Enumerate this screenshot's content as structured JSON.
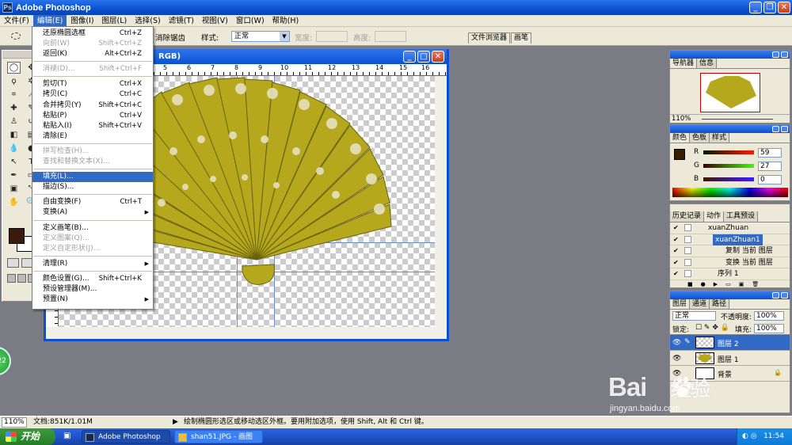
{
  "app": {
    "title": "Adobe Photoshop",
    "logo": "Ps"
  },
  "menubar": {
    "items": [
      "文件(F)",
      "编辑(E)",
      "图像(I)",
      "图层(L)",
      "选择(S)",
      "滤镜(T)",
      "视图(V)",
      "窗口(W)",
      "帮助(H)"
    ]
  },
  "options": {
    "elim": "消除锯齿",
    "style_label": "样式:",
    "style_value": "正常",
    "width_label": "宽度:",
    "height_label": "高度:",
    "well_tabs": [
      "文件浏览器",
      "画笔"
    ]
  },
  "edit_menu": {
    "sections": [
      [
        {
          "label": "还原椭圆选框",
          "shortcut": "Ctrl+Z"
        },
        {
          "label": "向前(W)",
          "shortcut": "Shift+Ctrl+Z",
          "disabled": true
        },
        {
          "label": "返回(K)",
          "shortcut": "Alt+Ctrl+Z"
        }
      ],
      [
        {
          "label": "消褪(D)...",
          "shortcut": "Shift+Ctrl+F",
          "disabled": true
        }
      ],
      [
        {
          "label": "剪切(T)",
          "shortcut": "Ctrl+X"
        },
        {
          "label": "拷贝(C)",
          "shortcut": "Ctrl+C"
        },
        {
          "label": "合并拷贝(Y)",
          "shortcut": "Shift+Ctrl+C"
        },
        {
          "label": "粘贴(P)",
          "shortcut": "Ctrl+V"
        },
        {
          "label": "粘贴入(I)",
          "shortcut": "Shift+Ctrl+V"
        },
        {
          "label": "清除(E)",
          "shortcut": ""
        }
      ],
      [
        {
          "label": "拼写检查(H)...",
          "shortcut": "",
          "disabled": true
        },
        {
          "label": "查找和替换文本(X)...",
          "shortcut": "",
          "disabled": true
        }
      ],
      [
        {
          "label": "填充(L)...",
          "shortcut": "",
          "highlighted": true
        },
        {
          "label": "描边(S)...",
          "shortcut": ""
        }
      ],
      [
        {
          "label": "自由变换(F)",
          "shortcut": "Ctrl+T"
        },
        {
          "label": "变换(A)",
          "shortcut": "",
          "submenu": true
        }
      ],
      [
        {
          "label": "定义画笔(B)...",
          "shortcut": ""
        },
        {
          "label": "定义图案(Q)...",
          "shortcut": "",
          "disabled": true
        },
        {
          "label": "定义自定形状(J)...",
          "shortcut": "",
          "disabled": true
        }
      ],
      [
        {
          "label": "清理(R)",
          "shortcut": "",
          "submenu": true
        }
      ],
      [
        {
          "label": "颜色设置(G)...",
          "shortcut": "Shift+Ctrl+K"
        },
        {
          "label": "预设管理器(M)...",
          "shortcut": ""
        },
        {
          "label": "预置(N)",
          "shortcut": "",
          "submenu": true
        }
      ]
    ]
  },
  "document": {
    "title_suffix": "RGB)",
    "ruler_numbers": [
      "5",
      "6",
      "7",
      "8",
      "9",
      "10",
      "11",
      "12",
      "13",
      "14",
      "15",
      "16",
      "17",
      "18"
    ]
  },
  "navigator": {
    "tabs": [
      "导航器",
      "信息"
    ],
    "zoom": "110%"
  },
  "color": {
    "tabs": [
      "颜色",
      "色板",
      "样式"
    ],
    "r_label": "R",
    "g_label": "G",
    "b_label": "B",
    "r": "59",
    "g": "27",
    "b": "0",
    "foreground_hex": "#3b1b00"
  },
  "actions": {
    "tabs": [
      "历史记录",
      "动作",
      "工具预设"
    ],
    "rows": [
      {
        "text": "xuanZhuan",
        "indent": 1
      },
      {
        "text": "xuanZhuan1",
        "indent": 1,
        "selected": true
      },
      {
        "text": "复制 当前 图层",
        "indent": 3
      },
      {
        "text": "变换 当前 图层",
        "indent": 2
      },
      {
        "text": "序列 1",
        "indent": 0
      }
    ]
  },
  "layers": {
    "tabs": [
      "图层",
      "通道",
      "路径"
    ],
    "blend": "正常",
    "opacity_label": "不透明度:",
    "opacity": "100%",
    "lock_label": "锁定:",
    "fill_label": "填充:",
    "fill": "100%",
    "items": [
      {
        "name": "图层 2",
        "selected": true
      },
      {
        "name": "图层 1",
        "selected": false
      },
      {
        "name": "背景",
        "selected": false,
        "locked": true
      }
    ]
  },
  "status": {
    "zoom": "110%",
    "doc": "文档:851K/1.01M",
    "hint": "绘制椭圆形选区或移动选区外框。要用附加选项，使用 Shift, Alt 和 Ctrl 键。"
  },
  "taskbar": {
    "start": "开始",
    "tasks": [
      "Adobe Photoshop",
      "shan51.JPG - 画图"
    ],
    "clock": "11:54"
  },
  "watermark": {
    "main": "Bai",
    "main2": "经验",
    "sub": "jingyan.baidu.com"
  },
  "badge": "22",
  "accent_hex": "#316ac5",
  "fan_color_hex": "#b5a81c"
}
